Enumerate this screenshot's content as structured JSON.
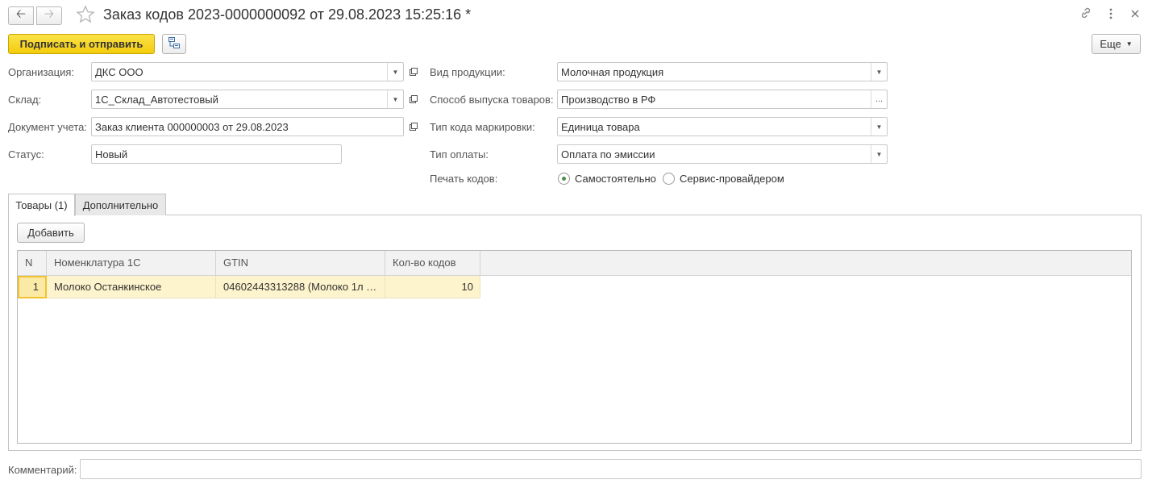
{
  "header": {
    "title": "Заказ кодов 2023-0000000092 от 29.08.2023 15:25:16 *",
    "back_icon": "arrow-left-icon",
    "forward_icon": "arrow-right-icon",
    "favorite_icon": "star-icon",
    "link_icon": "link-icon",
    "menu_icon": "more-vertical-icon",
    "close_icon": "close-icon"
  },
  "toolbar": {
    "sign_send_label": "Подписать и отправить",
    "structure_icon": "structure-icon",
    "more_label": "Еще"
  },
  "form": {
    "organization": {
      "label": "Организация:",
      "value": "ДКС ООО"
    },
    "warehouse": {
      "label": "Склад:",
      "value": "1С_Склад_Автотестовый"
    },
    "document": {
      "label": "Документ учета:",
      "value": "Заказ клиента 000000003 от 29.08.2023"
    },
    "status": {
      "label": "Статус:",
      "value": "Новый"
    },
    "product_kind": {
      "label": "Вид продукции:",
      "value": "Молочная продукция"
    },
    "release_method": {
      "label": "Способ выпуска товаров:",
      "value": "Производство в РФ"
    },
    "code_type": {
      "label": "Тип кода маркировки:",
      "value": "Единица товара"
    },
    "payment_type": {
      "label": "Тип оплаты:",
      "value": "Оплата по эмиссии"
    },
    "print_codes": {
      "label": "Печать кодов:",
      "options": [
        "Самостоятельно",
        "Сервис-провайдером"
      ],
      "selected": "Самостоятельно"
    }
  },
  "tabs": [
    {
      "label": "Товары (1)",
      "active": true
    },
    {
      "label": "Дополнительно",
      "active": false
    }
  ],
  "goods": {
    "add_label": "Добавить",
    "columns": [
      "N",
      "Номенклатура 1С",
      "GTIN",
      "Кол-во кодов"
    ],
    "rows": [
      {
        "n": "1",
        "nomenclature": "Молоко Останкинское",
        "gtin": "04602443313288 (Молоко 1л 0...",
        "qty": "10"
      }
    ]
  },
  "comment": {
    "label": "Комментарий:",
    "value": ""
  },
  "colors": {
    "primary_button": "#f2cc0d",
    "selected_row": "#fdf3cc",
    "radio_selected": "#4a8f4a"
  }
}
